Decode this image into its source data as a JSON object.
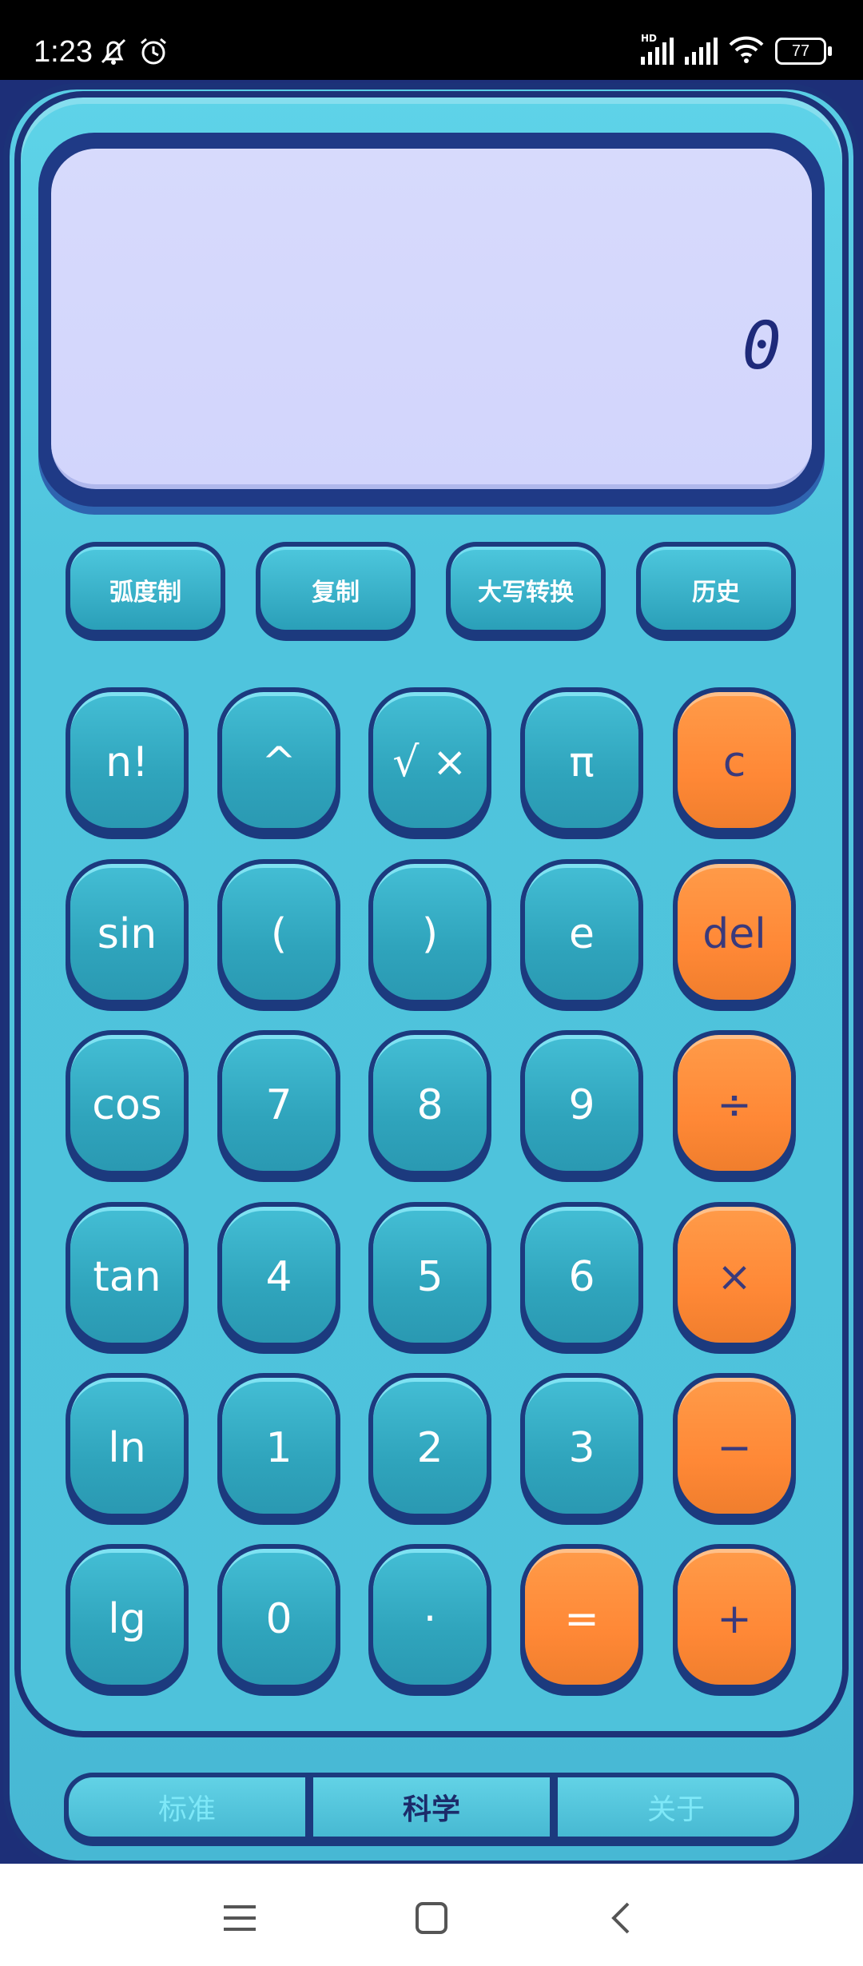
{
  "status_bar": {
    "time": "1:23",
    "battery": "77",
    "network_label": "HD",
    "icons": [
      "mute-bell-icon",
      "alarm-icon",
      "signal-icon",
      "signal-icon",
      "wifi-icon",
      "battery-icon"
    ]
  },
  "display": {
    "value": "0"
  },
  "function_buttons": [
    {
      "label": "弧度制",
      "name": "radian-mode-button"
    },
    {
      "label": "复制",
      "name": "copy-button"
    },
    {
      "label": "大写转换",
      "name": "uppercase-convert-button"
    },
    {
      "label": "历史",
      "name": "history-button"
    }
  ],
  "keys": [
    [
      "n!",
      "^",
      "√ ×",
      "π",
      "c"
    ],
    [
      "sin",
      "(",
      ")",
      "e",
      "del"
    ],
    [
      "cos",
      "7",
      "8",
      "9",
      "÷"
    ],
    [
      "tan",
      "4",
      "5",
      "6",
      "×"
    ],
    [
      "ln",
      "1",
      "2",
      "3",
      "−"
    ],
    [
      "lg",
      "0",
      "·",
      "=",
      "+"
    ]
  ],
  "tabs": [
    {
      "label": "标准",
      "active": false
    },
    {
      "label": "科学",
      "active": true
    },
    {
      "label": "关于",
      "active": false
    }
  ],
  "colors": {
    "body": "#4fc4dd",
    "frame": "#1c3278",
    "key": "#2fa4bc",
    "operator_key": "#ff8836",
    "screen": "#d3d6fc"
  },
  "nav_icons": [
    "menu-icon",
    "home-icon",
    "back-icon"
  ]
}
